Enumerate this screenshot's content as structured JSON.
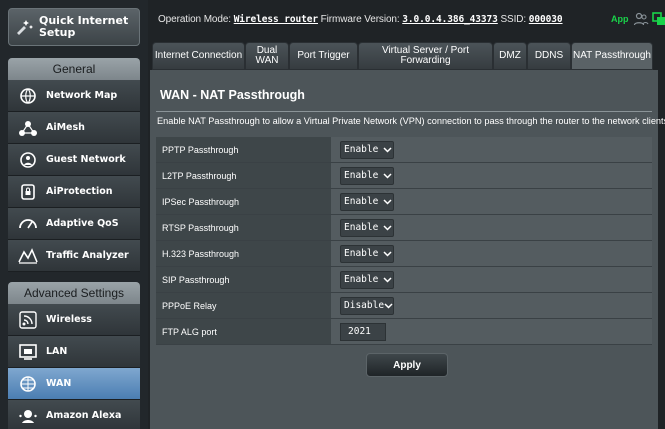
{
  "sidebar": {
    "quick_setup": "Quick Internet Setup",
    "general_header": "General",
    "general_items": [
      {
        "label": "Network Map",
        "icon": "network-map-icon"
      },
      {
        "label": "AiMesh",
        "icon": "aimesh-icon"
      },
      {
        "label": "Guest Network",
        "icon": "guest-network-icon"
      },
      {
        "label": "AiProtection",
        "icon": "aiprotection-icon"
      },
      {
        "label": "Adaptive QoS",
        "icon": "adaptive-qos-icon"
      },
      {
        "label": "Traffic Analyzer",
        "icon": "traffic-analyzer-icon"
      }
    ],
    "advanced_header": "Advanced Settings",
    "advanced_items": [
      {
        "label": "Wireless",
        "icon": "wireless-icon"
      },
      {
        "label": "LAN",
        "icon": "lan-icon"
      },
      {
        "label": "WAN",
        "icon": "wan-icon",
        "active": true
      },
      {
        "label": "Amazon Alexa",
        "icon": "amazon-alexa-icon"
      }
    ]
  },
  "topbar": {
    "operation_mode_label": "Operation Mode:",
    "operation_mode_value": "Wireless router",
    "firmware_label": "Firmware Version:",
    "firmware_value": "3.0.0.4.386_43373",
    "ssid_label": "SSID:",
    "ssid_value": "000030",
    "app_label": "App"
  },
  "tabs": [
    {
      "label": "Internet Connection"
    },
    {
      "label": "Dual WAN"
    },
    {
      "label": "Port Trigger"
    },
    {
      "label": "Virtual Server / Port Forwarding"
    },
    {
      "label": "DMZ"
    },
    {
      "label": "DDNS"
    },
    {
      "label": "NAT Passthrough",
      "active": true
    }
  ],
  "main": {
    "title": "WAN - NAT Passthrough",
    "description": "Enable NAT Passthrough to allow a Virtual Private Network (VPN) connection to pass through the router to the network clients.",
    "rows": [
      {
        "label": "PPTP Passthrough",
        "type": "select",
        "value": "Enable"
      },
      {
        "label": "L2TP Passthrough",
        "type": "select",
        "value": "Enable"
      },
      {
        "label": "IPSec Passthrough",
        "type": "select",
        "value": "Enable"
      },
      {
        "label": "RTSP Passthrough",
        "type": "select",
        "value": "Enable"
      },
      {
        "label": "H.323 Passthrough",
        "type": "select",
        "value": "Enable"
      },
      {
        "label": "SIP Passthrough",
        "type": "select",
        "value": "Enable"
      },
      {
        "label": "PPPoE Relay",
        "type": "select",
        "value": "Disable"
      },
      {
        "label": "FTP ALG port",
        "type": "text",
        "value": "2021"
      }
    ],
    "apply_label": "Apply"
  },
  "colors": {
    "accent_active": "#5b8cc0",
    "app_green": "#19d34a",
    "content_bg": "#4d5559"
  }
}
